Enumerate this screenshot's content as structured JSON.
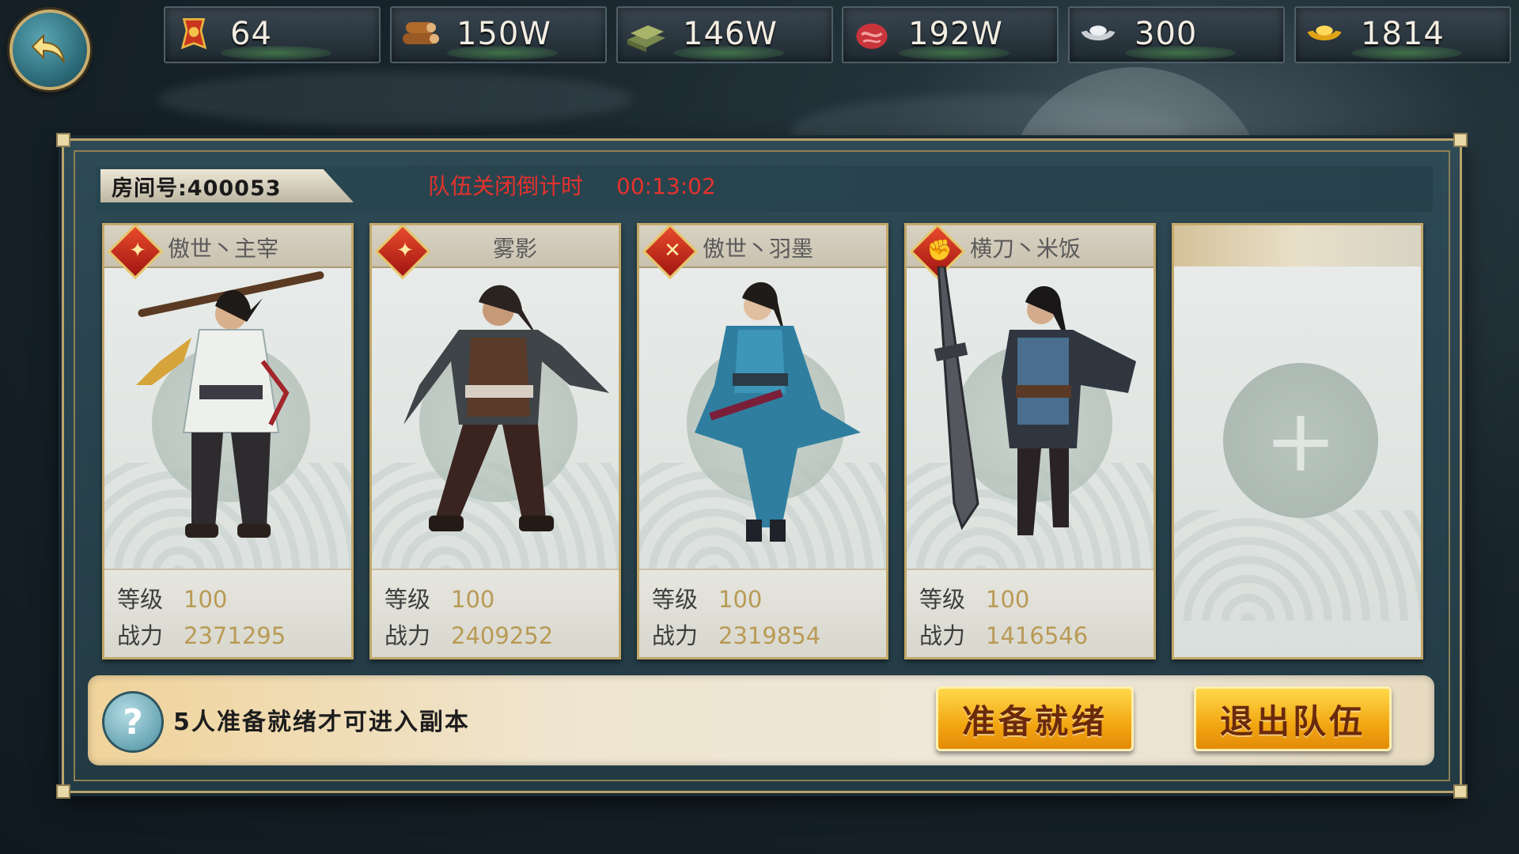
{
  "resources": [
    {
      "icon": "token-flag-icon",
      "value": "64"
    },
    {
      "icon": "wood-logs-icon",
      "value": "150W"
    },
    {
      "icon": "stone-bricks-icon",
      "value": "146W"
    },
    {
      "icon": "meat-icon",
      "value": "192W"
    },
    {
      "icon": "silver-ingot-icon",
      "value": "300"
    },
    {
      "icon": "gold-ingot-icon",
      "value": "1814"
    }
  ],
  "room": {
    "room_label": "房间号:400053",
    "countdown_label": "队伍关闭倒计时",
    "countdown_time": "00:13:02"
  },
  "members": [
    {
      "name": "傲世丶主宰",
      "badge": "dagger-icon",
      "level_label": "等级",
      "level": "100",
      "power_label": "战力",
      "power": "2371295"
    },
    {
      "name": "雾影",
      "badge": "dagger-icon",
      "level_label": "等级",
      "level": "100",
      "power_label": "战力",
      "power": "2409252"
    },
    {
      "name": "傲世丶羽墨",
      "badge": "crossed-swords-icon",
      "level_label": "等级",
      "level": "100",
      "power_label": "战力",
      "power": "2319854"
    },
    {
      "name": "横刀丶米饭",
      "badge": "fist-icon",
      "level_label": "等级",
      "level": "100",
      "power_label": "战力",
      "power": "1416546"
    }
  ],
  "empty_slot": {
    "symbol": "+"
  },
  "footer": {
    "hint": "5人准备就绪才可进入副本",
    "ready_button": "准备就绪",
    "quit_button": "退出队伍"
  },
  "colors": {
    "countdown": "#e5322d",
    "stat_value": "#b99a55",
    "button_text": "#6b2a0c"
  }
}
